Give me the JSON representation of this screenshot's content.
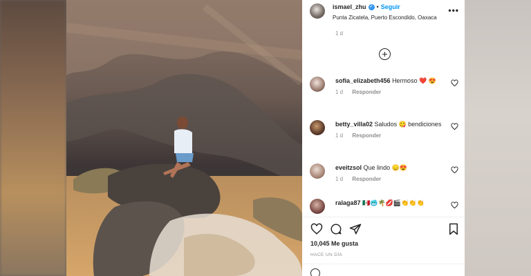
{
  "post": {
    "username": "ismael_zhu",
    "verified_mark": "✓",
    "separator": "•",
    "follow_label": "Seguir",
    "location": "Punta Zicatela, Puerto Escondido, Oaxaca",
    "more_label": "•••",
    "caption_time": "1 d",
    "load_more_icon": "+",
    "likes": "10,045 Me gusta",
    "posted_ago": "HACE UN DÍA"
  },
  "comments": [
    {
      "user": "sofia_elizabeth456",
      "text": "Hermoso ❤️ 😍",
      "time": "1 d",
      "reply": "Responder"
    },
    {
      "user": "betty_villa02",
      "text": "Saludos 😋 bendiciones",
      "time": "1 d",
      "reply": "Responder"
    },
    {
      "user": "eveitzsol",
      "text": "Que lindo 😞😍",
      "time": "1 d",
      "reply": "Responder"
    },
    {
      "user": "ralaga87",
      "text": "🇲🇽🥶🌴💋🎬👏👏👏",
      "time": "",
      "reply": ""
    }
  ],
  "icons": {
    "like": "heart-icon",
    "comment": "comment-icon",
    "share": "paper-plane-icon",
    "save": "bookmark-icon",
    "more": "more-options-icon",
    "add": "plus-circle-icon",
    "emoji": "emoji-icon"
  },
  "colors": {
    "accent": "#0095f6",
    "text": "#262626",
    "muted": "#8e8e8e"
  }
}
